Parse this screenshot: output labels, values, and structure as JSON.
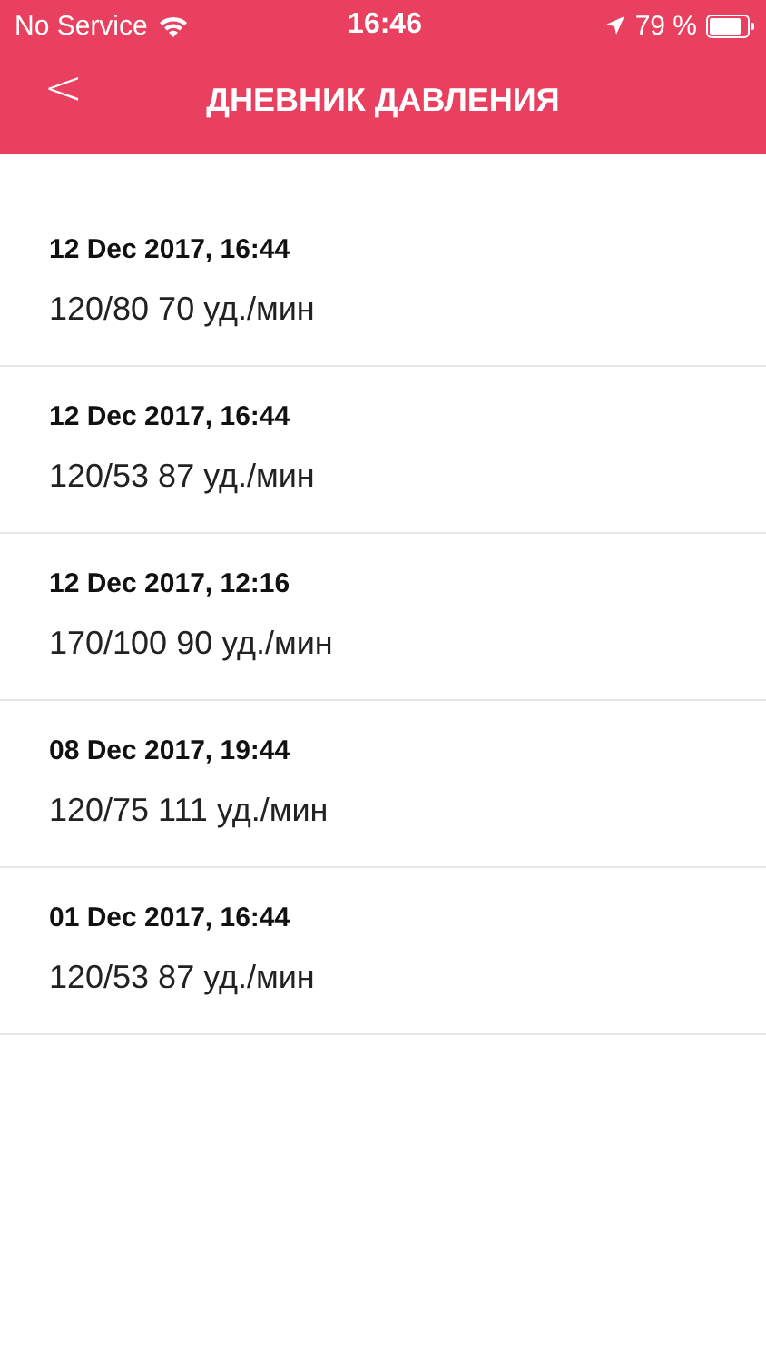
{
  "status_bar": {
    "carrier": "No Service",
    "time": "16:46",
    "battery": "79 %"
  },
  "nav": {
    "back": "<",
    "title": "ДНЕВНИК ДАВЛЕНИЯ"
  },
  "entries": [
    {
      "date": "12 Dec 2017, 16:44",
      "reading": "120/80 70 уд./мин"
    },
    {
      "date": "12 Dec 2017, 16:44",
      "reading": "120/53 87 уд./мин"
    },
    {
      "date": "12 Dec 2017, 12:16",
      "reading": "170/100 90 уд./мин"
    },
    {
      "date": "08 Dec 2017, 19:44",
      "reading": "120/75 111 уд./мин"
    },
    {
      "date": "01 Dec 2017, 16:44",
      "reading": "120/53 87 уд./мин"
    }
  ]
}
